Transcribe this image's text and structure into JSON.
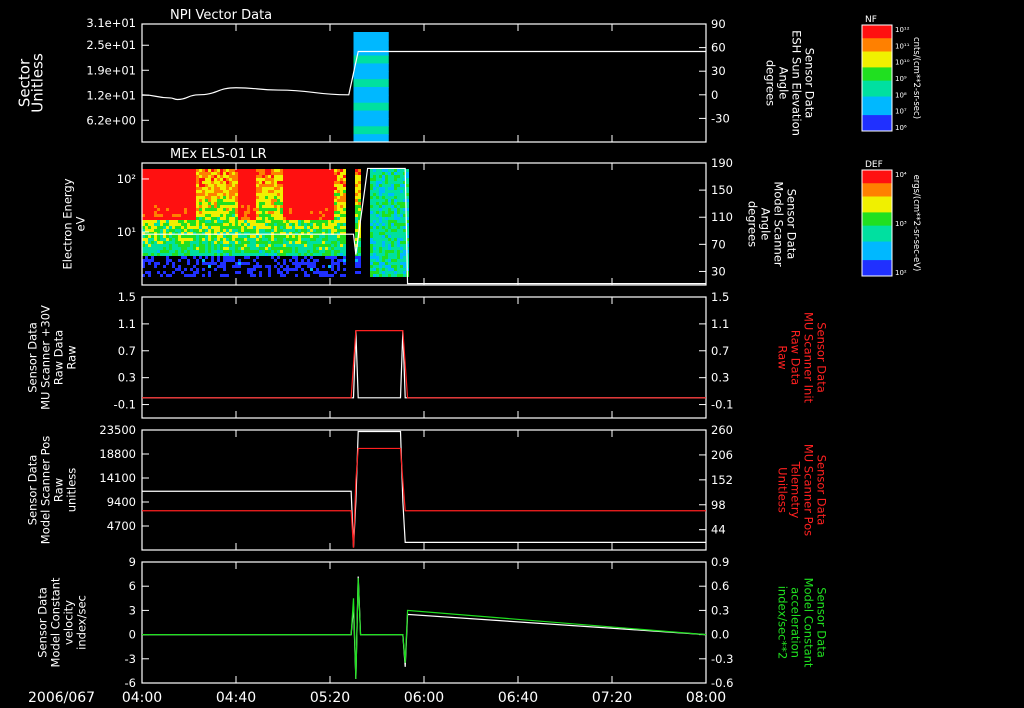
{
  "date_label": "2006/067",
  "x_ticks": [
    "04:00",
    "04:40",
    "05:20",
    "06:00",
    "06:40",
    "07:20",
    "08:00"
  ],
  "colorbars": [
    {
      "tag": "NF",
      "unit": "cnts/(cm**2-sr-sec)",
      "ticks": [
        "10¹²",
        "10¹¹",
        "10¹⁰",
        "10⁹",
        "10⁸",
        "10⁷",
        "10⁶"
      ]
    },
    {
      "tag": "DEF",
      "unit": "ergs/(cm**2-sr-sec-eV)",
      "ticks": [
        "10⁴",
        "10³",
        "10²"
      ]
    }
  ],
  "colors": {
    "white": "#ffffff",
    "red": "#ff2020",
    "green": "#20e020",
    "background": "#000000"
  },
  "chart_data": [
    {
      "type": "line",
      "title": "NPI Vector Data",
      "ylabel": [
        "Sector",
        "Unitless"
      ],
      "ylim_label": "3.1e+01",
      "yticks": [
        "2.5e+01",
        "1.9e+01",
        "1.2e+01",
        "6.2e+00"
      ],
      "y2label": [
        "Sensor Data",
        "ESH Sun Elevation",
        "Angle",
        "degrees"
      ],
      "y2ticks": [
        "90",
        "60",
        "30",
        "0",
        "-30"
      ],
      "y2lim": [
        -60,
        90
      ],
      "series": [
        {
          "axis": "right",
          "x": [
            "04:00",
            "04:12",
            "04:15",
            "04:24",
            "04:40",
            "04:58",
            "05:28",
            "05:32",
            "05:52",
            "08:00"
          ],
          "values": [
            0,
            -4,
            -6,
            0,
            9,
            6,
            0,
            55,
            55,
            55
          ]
        }
      ],
      "spectrogram": {
        "x_range": [
          "05:30",
          "05:45"
        ]
      }
    },
    {
      "type": "heatmap",
      "title": "MEx ELS-01 LR",
      "ylabel": [
        "Electron Energy",
        "eV"
      ],
      "yticks": [
        "10²",
        "10¹"
      ],
      "ylim": [
        1,
        200
      ],
      "y2label": [
        "Sensor Data",
        "Model Scanner",
        "Angle",
        "degrees"
      ],
      "y2ticks": [
        "190",
        "150",
        "110",
        "70",
        "30"
      ],
      "y2lim": [
        10,
        190
      ],
      "series": [
        {
          "axis": "right",
          "x": [
            "04:00",
            "05:30",
            "05:31",
            "05:36",
            "05:52",
            "05:53",
            "08:00"
          ],
          "values": [
            85,
            85,
            55,
            182,
            182,
            12,
            12
          ]
        }
      ],
      "spectrogram": {
        "x_range": [
          "04:00",
          "05:53"
        ]
      }
    },
    {
      "type": "line",
      "ylabel": [
        "Sensor Data",
        "MU Scanner +30V",
        "Raw Data",
        "Raw"
      ],
      "yticks": [
        "1.5",
        "1.1",
        "0.7",
        "0.3",
        "-0.1"
      ],
      "ylim": [
        -0.3,
        1.5
      ],
      "y2label": [
        "Sensor Data",
        "MU Scanner Init",
        "Raw Data",
        "Raw"
      ],
      "y2ticks": [
        "1.5",
        "1.1",
        "0.7",
        "0.3",
        "-0.1"
      ],
      "y2lim": [
        -0.3,
        1.5
      ],
      "series": [
        {
          "color": "white",
          "x": [
            "04:00",
            "05:30",
            "05:31",
            "05:32",
            "05:50",
            "05:51",
            "05:52",
            "08:00"
          ],
          "values": [
            0,
            0,
            1,
            0,
            0,
            1,
            0,
            0
          ]
        },
        {
          "color": "red",
          "x": [
            "04:00",
            "05:29",
            "05:31",
            "05:51",
            "05:53",
            "08:00"
          ],
          "values": [
            0,
            0,
            1,
            1,
            0,
            0
          ]
        }
      ]
    },
    {
      "type": "line",
      "ylabel": [
        "Sensor Data",
        "Model Scanner Pos",
        "Raw",
        "unitless"
      ],
      "yticks": [
        "23500",
        "18800",
        "14100",
        "9400",
        "4700"
      ],
      "ylim": [
        0,
        23500
      ],
      "y2label": [
        "Sensor Data",
        "MU Scanner Pos",
        "Telemetry",
        "Unitless"
      ],
      "y2ticks": [
        "260",
        "206",
        "152",
        "98",
        "44"
      ],
      "y2lim": [
        0,
        260
      ],
      "series": [
        {
          "color": "white",
          "x": [
            "04:00",
            "05:29",
            "05:30",
            "05:31",
            "05:32",
            "05:50",
            "05:51",
            "05:52",
            "08:00"
          ],
          "values": [
            11500,
            11500,
            500,
            9500,
            23200,
            23200,
            9500,
            1500,
            1500
          ]
        },
        {
          "color": "red",
          "axis": "right",
          "x": [
            "04:00",
            "05:29",
            "05:30",
            "05:31",
            "05:32",
            "05:50",
            "05:51",
            "05:52",
            "08:00"
          ],
          "values": [
            85,
            85,
            5,
            150,
            220,
            220,
            150,
            85,
            85
          ]
        }
      ]
    },
    {
      "type": "line",
      "ylabel": [
        "Sensor Data",
        "Model Constant",
        "velocity",
        "index/sec"
      ],
      "yticks": [
        "9",
        "6",
        "3",
        "0",
        "-3",
        "-6"
      ],
      "ylim": [
        -6,
        9
      ],
      "y2label": [
        "Sensor Data",
        "Model Constant",
        "acceleration",
        "index/sec**2"
      ],
      "y2ticks": [
        "0.9",
        "0.6",
        "0.3",
        "0.0",
        "-0.3",
        "-0.6"
      ],
      "y2lim": [
        -0.6,
        0.9
      ],
      "series": [
        {
          "color": "white",
          "x": [
            "04:00",
            "05:29",
            "05:30",
            "05:31",
            "05:32",
            "05:33",
            "05:51",
            "05:52",
            "05:53",
            "08:00"
          ],
          "values": [
            0,
            0,
            3.5,
            -5.5,
            7.2,
            0,
            0,
            -4,
            2.5,
            0
          ]
        },
        {
          "color": "green",
          "axis": "right",
          "x": [
            "04:00",
            "05:29",
            "05:30",
            "05:31",
            "05:32",
            "05:33",
            "05:51",
            "05:52",
            "05:53",
            "08:00"
          ],
          "values": [
            0,
            0,
            0.45,
            -0.55,
            0.7,
            0,
            0,
            -0.35,
            0.3,
            0
          ]
        }
      ]
    }
  ]
}
